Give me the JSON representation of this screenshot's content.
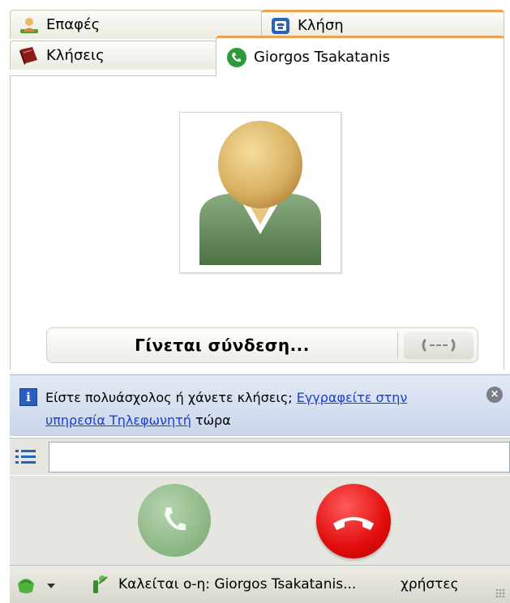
{
  "tabs": {
    "contacts_label": "Επαφές",
    "call_label": "Κλήση",
    "calls_label": "Κλήσεις",
    "active_label": "Giorgos Tsakatanis"
  },
  "call": {
    "status": "Γίνεται σύνδεση..."
  },
  "info_bar": {
    "text": "Είστε πολυάσχολος ή χάνετε κλήσεις;",
    "link": "Εγγραφείτε στην υπηρεσία Τηλεφωνητή",
    "suffix": "τώρα"
  },
  "dial": {
    "value": ""
  },
  "status_bar": {
    "text": "Καλείται ο-η: Giorgos Tsakatanis...",
    "users": "χρήστες"
  },
  "colors": {
    "tab_accent": "#f0a050",
    "end_call": "#e10d0d",
    "call_disabled": "#8fba88",
    "link": "#1a3fd6",
    "info_background": "#c9d6ea"
  },
  "icons": {
    "contacts": "contacts-person-icon",
    "call": "phone-dialpad-icon",
    "calls": "call-history-book-icon",
    "active": "green-phone-icon",
    "info": "info-icon",
    "close": "close-icon",
    "dial": "dialpad-list-icon",
    "status": "online-status-icon",
    "ptt": "ptt-icon"
  }
}
